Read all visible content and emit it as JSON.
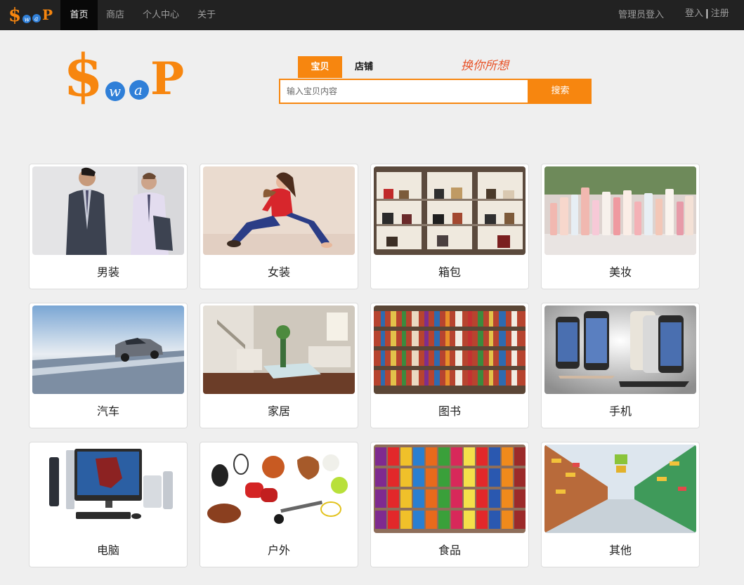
{
  "navbar": {
    "brand_logo_text": "SwaP",
    "items": [
      {
        "label": "首页",
        "active": true
      },
      {
        "label": "商店",
        "active": false
      },
      {
        "label": "个人中心",
        "active": false
      },
      {
        "label": "关于",
        "active": false
      }
    ],
    "admin_login": "管理员登入",
    "login": "登入",
    "separator": "|",
    "register": "注册"
  },
  "logo": {
    "text": "SwaP",
    "slogan": "换你所想"
  },
  "search": {
    "tabs": [
      {
        "label": "宝贝",
        "active": true
      },
      {
        "label": "店铺",
        "active": false
      }
    ],
    "placeholder": "输入宝贝内容",
    "button_label": "搜索"
  },
  "categories": [
    {
      "label": "男装",
      "icon": "menswear-image"
    },
    {
      "label": "女装",
      "icon": "womenswear-image"
    },
    {
      "label": "箱包",
      "icon": "bags-image"
    },
    {
      "label": "美妆",
      "icon": "cosmetics-image"
    },
    {
      "label": "汽车",
      "icon": "car-image"
    },
    {
      "label": "家居",
      "icon": "home-image"
    },
    {
      "label": "图书",
      "icon": "books-image"
    },
    {
      "label": "手机",
      "icon": "phone-image"
    },
    {
      "label": "电脑",
      "icon": "computer-image"
    },
    {
      "label": "户外",
      "icon": "outdoor-image"
    },
    {
      "label": "食品",
      "icon": "food-image"
    },
    {
      "label": "其他",
      "icon": "other-image"
    }
  ],
  "colors": {
    "accent": "#f7860f",
    "navbar": "#222222",
    "logo_blue": "#2f7fd8"
  }
}
